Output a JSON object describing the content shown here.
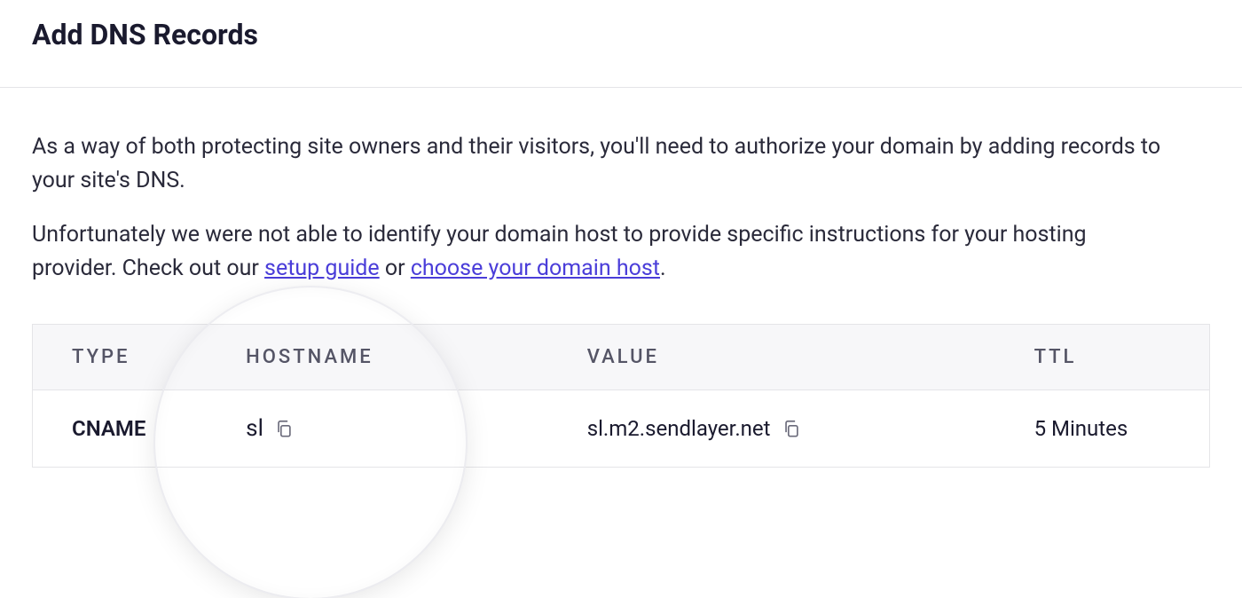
{
  "title": "Add DNS Records",
  "intro_paragraphs": {
    "p1": "As a way of both protecting site owners and their visitors, you'll need to authorize your domain by adding records to your site's DNS.",
    "p2_before": "Unfortunately we were not able to identify your domain host to provide specific instructions for your hosting provider. Check out our ",
    "link1": "setup guide",
    "p2_mid": " or ",
    "link2": "choose your domain host",
    "p2_after": "."
  },
  "table": {
    "headers": {
      "type": "TYPE",
      "hostname": "HOSTNAME",
      "value": "VALUE",
      "ttl": "TTL"
    },
    "rows": [
      {
        "type": "CNAME",
        "hostname": "sl",
        "value": "sl.m2.sendlayer.net",
        "ttl": "5 Minutes"
      }
    ]
  }
}
